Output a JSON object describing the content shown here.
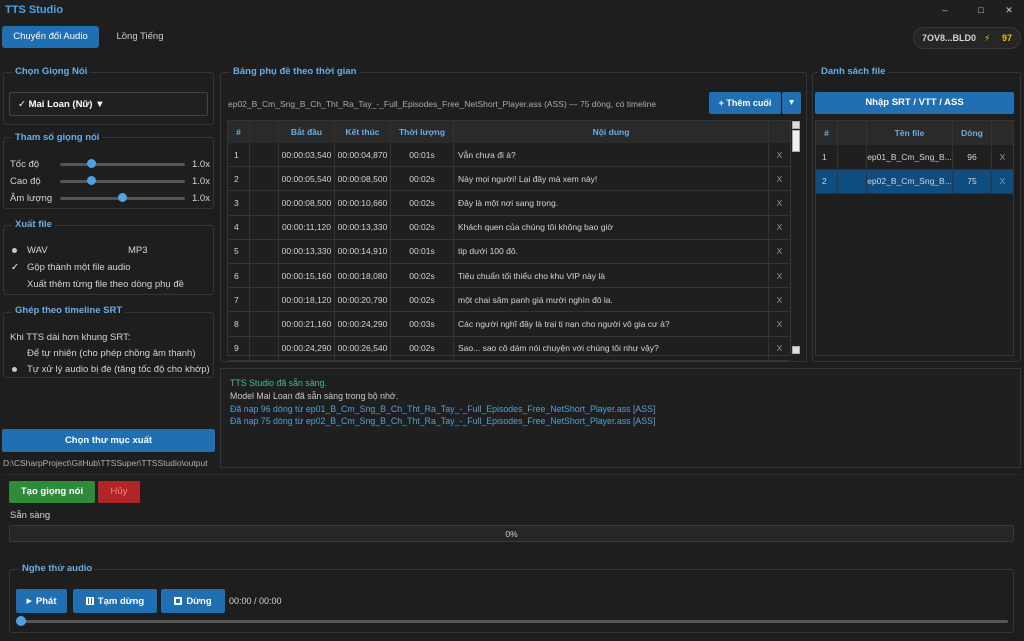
{
  "app": {
    "title": "TTS Studio"
  },
  "window_controls": {
    "minimize": "–",
    "maximize": "□",
    "close": "✕"
  },
  "tabs": [
    {
      "label": "Chuyển đổi Audio"
    },
    {
      "label": "Lồng Tiếng"
    }
  ],
  "account": {
    "id": "7OV8...BLD0",
    "bolt": "⚡",
    "credits": "97"
  },
  "voice": {
    "title": "Chọn Giọng Nói",
    "selected": "✓ Mai Loan (Nữ) ▼"
  },
  "params": {
    "title": "Tham số giọng nói",
    "items": [
      {
        "label": "Tốc độ",
        "value": "1.0x",
        "level": 0.25
      },
      {
        "label": "Cao độ",
        "value": "1.0x",
        "level": 0.25
      },
      {
        "label": "Âm lượng",
        "value": "1.0x",
        "level": 0.5
      }
    ]
  },
  "export": {
    "title": "Xuất file",
    "wav": "WAV",
    "mp3": "MP3",
    "merge_check": "✓",
    "merge": "Gộp thành một file audio",
    "per_line": "Xuất thêm từng file theo dòng phụ đề"
  },
  "timeline": {
    "title": "Ghép theo timeline SRT",
    "hint": "Khi TTS dài hơn khung SRT:",
    "opt1": "Để tự nhiên (cho phép chồng âm thanh)",
    "opt2": "Tự xử lý audio bị đè (tăng tốc độ cho khớp)"
  },
  "output": {
    "button": "Chọn thư mục xuất",
    "path": "D:\\CSharpProject\\GitHub\\TTSSuper\\TTSStudio\\output"
  },
  "subtitle": {
    "title": "Bảng phụ đề theo thời gian",
    "info": "ep02_B_Cm_Sng_B_Ch_Tht_Ra_Tay_-_Full_Episodes_Free_NetShort_Player.ass (ASS) — 75 dòng, có timeline",
    "add_button": "+ Thêm cuối",
    "add_dropdown": "▾",
    "columns": [
      "#",
      "Bắt đầu",
      "Kết thúc",
      "Thời lượng",
      "Nội dung"
    ],
    "delete_glyph": "X",
    "rows": [
      {
        "n": "1",
        "start": "00:00:03,540",
        "end": "00:00:04,870",
        "dur": "00:01s",
        "text": "Vẫn chưa đi à?"
      },
      {
        "n": "2",
        "start": "00:00:05,540",
        "end": "00:00:08,500",
        "dur": "00:02s",
        "text": "Này mọi người! Lại đây mà xem này!"
      },
      {
        "n": "3",
        "start": "00:00:08,500",
        "end": "00:00:10,660",
        "dur": "00:02s",
        "text": "Đây là một nơi sang trọng."
      },
      {
        "n": "4",
        "start": "00:00:11,120",
        "end": "00:00:13,330",
        "dur": "00:02s",
        "text": "Khách quen của chúng tôi không bao giờ"
      },
      {
        "n": "5",
        "start": "00:00:13,330",
        "end": "00:00:14,910",
        "dur": "00:01s",
        "text": "tip dưới 100 đô."
      },
      {
        "n": "6",
        "start": "00:00:15,160",
        "end": "00:00:18,080",
        "dur": "00:02s",
        "text": "Tiêu chuẩn tối thiểu cho khu VIP này là"
      },
      {
        "n": "7",
        "start": "00:00:18,120",
        "end": "00:00:20,790",
        "dur": "00:02s",
        "text": "một chai sâm panh giá mười nghìn đô la."
      },
      {
        "n": "8",
        "start": "00:00:21,160",
        "end": "00:00:24,290",
        "dur": "00:03s",
        "text": "Các người nghĩ đây là trại tị nạn cho người vô gia cư à?"
      },
      {
        "n": "9",
        "start": "00:00:24,290",
        "end": "00:00:26,540",
        "dur": "00:02s",
        "text": "Sao... sao cô dám nói chuyện với chúng tôi như vậy?"
      }
    ]
  },
  "files": {
    "title": "Danh sách file",
    "import_button": "Nhập SRT / VTT / ASS",
    "columns": [
      "#",
      "Tên file",
      "Dòng"
    ],
    "rows": [
      {
        "n": "1",
        "name": "ep01_B_Cm_Sng_B...",
        "lines": "96"
      },
      {
        "n": "2",
        "name": "ep02_B_Cm_Sng_B...",
        "lines": "75"
      }
    ]
  },
  "log": {
    "lines": [
      "TTS Studio đã sẵn sàng.",
      "Model Mai Loan đã sẵn sàng trong bộ nhớ.",
      "Đã nạp 96 dòng từ ep01_B_Cm_Sng_B_Ch_Tht_Ra_Tay_-_Full_Episodes_Free_NetShort_Player.ass [ASS]",
      "Đã nạp 75 dòng từ ep02_B_Cm_Sng_B_Ch_Tht_Ra_Tay_-_Full_Episodes_Free_NetShort_Player.ass [ASS]"
    ]
  },
  "actions": {
    "generate": "Tạo giọng nói",
    "cancel": "Hủy",
    "status": "Sẵn sàng",
    "progress_text": "0%",
    "progress": 0
  },
  "player": {
    "title": "Nghe thử audio",
    "play": "Phát",
    "play_glyph": "▶",
    "pause": "Tạm dừng",
    "stop": "Dừng",
    "time": "00:00 / 00:00",
    "position": 0
  },
  "colors": {
    "accent": "#1f6fb2",
    "header": "#6aaee6",
    "green": "#2e8b3a",
    "red": "#b02525",
    "log_green": "#3fbf8f",
    "log_blue": "#4aa3d8"
  }
}
